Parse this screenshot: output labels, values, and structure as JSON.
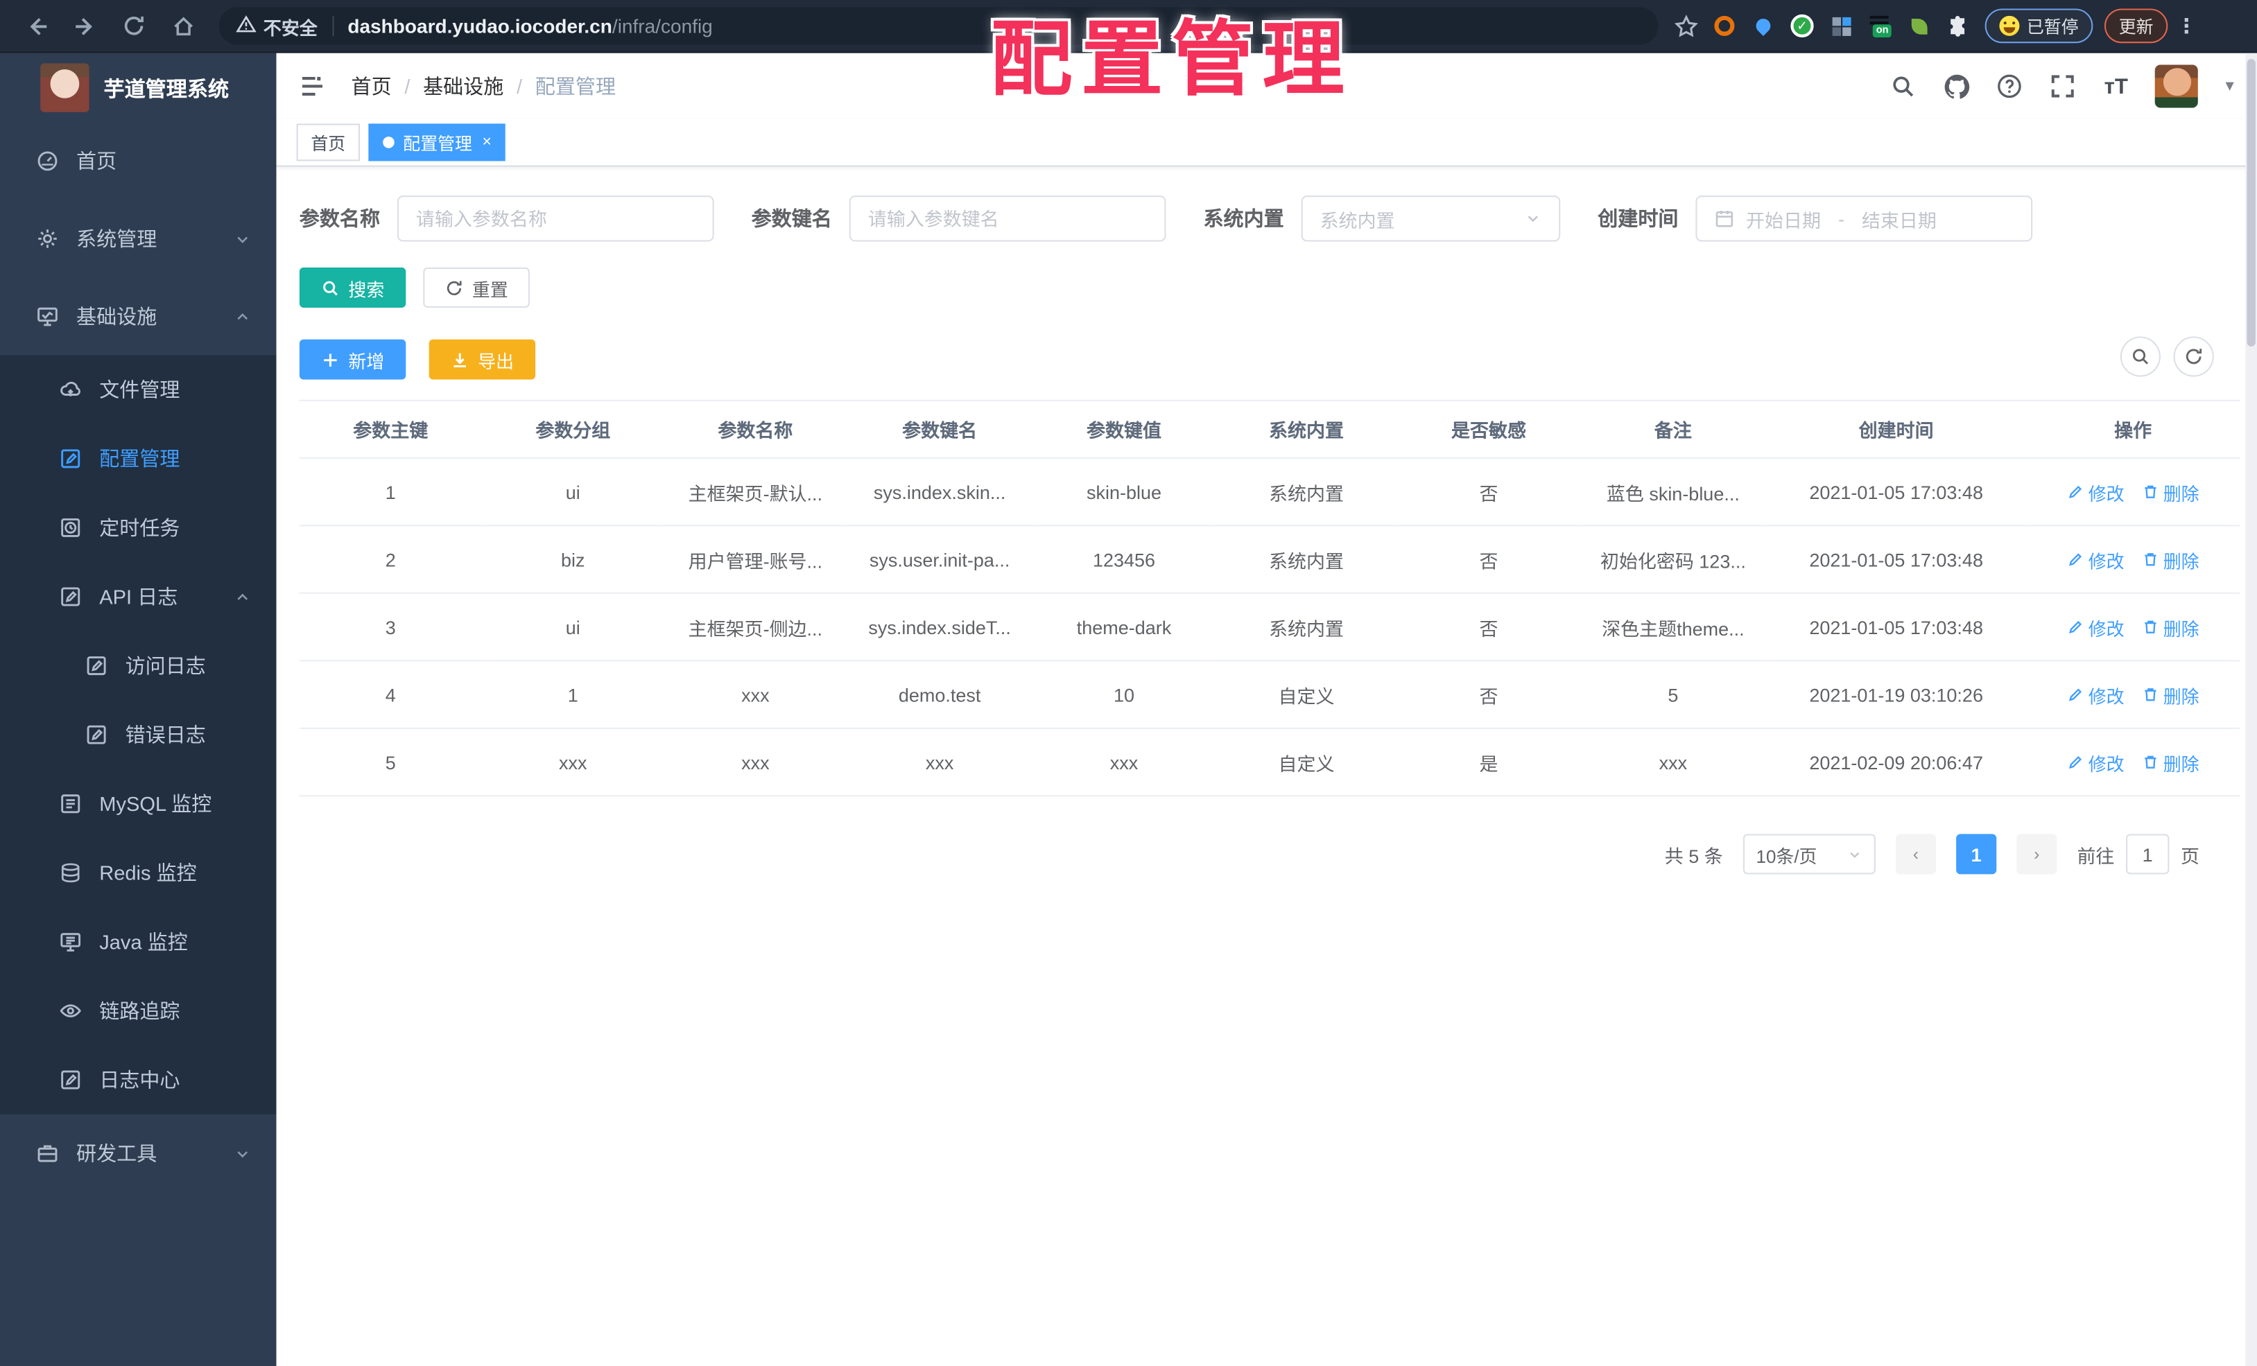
{
  "browser": {
    "security_label": "不安全",
    "url_host": "dashboard.yudao.iocoder.cn",
    "url_path": "/infra/config",
    "paused_chip": "已暂停",
    "update_button": "更新",
    "nav_icons": [
      "back-icon",
      "forward-icon",
      "reload-icon",
      "home-icon"
    ],
    "extension_icons": [
      "bookmark-star-icon",
      "orange-ring-icon",
      "blue-pin-icon",
      "green-check-icon",
      "grid-icon",
      "on-badge-icon",
      "leaf-icon",
      "puzzle-icon"
    ]
  },
  "watermark": "配置管理",
  "sidebar": {
    "title": "芋道管理系统",
    "items": [
      {
        "label": "首页",
        "icon": "dashboard-icon",
        "level": 1,
        "chevron": null,
        "active": false,
        "dark": false
      },
      {
        "label": "系统管理",
        "icon": "gear-icon",
        "level": 1,
        "chevron": "down",
        "active": false,
        "dark": false
      },
      {
        "label": "基础设施",
        "icon": "infra-monitor-icon",
        "level": 1,
        "chevron": "up",
        "active": false,
        "dark": false
      },
      {
        "label": "文件管理",
        "icon": "cloud-icon",
        "level": 2,
        "chevron": null,
        "active": false,
        "dark": true
      },
      {
        "label": "配置管理",
        "icon": "edit-square-icon",
        "level": 2,
        "chevron": null,
        "active": true,
        "dark": true
      },
      {
        "label": "定时任务",
        "icon": "clock-icon",
        "level": 2,
        "chevron": null,
        "active": false,
        "dark": true
      },
      {
        "label": "API 日志",
        "icon": "log-icon",
        "level": 2,
        "chevron": "up",
        "active": false,
        "dark": true
      },
      {
        "label": "访问日志",
        "icon": "log-icon",
        "level": 3,
        "chevron": null,
        "active": false,
        "dark": true
      },
      {
        "label": "错误日志",
        "icon": "log-icon",
        "level": 3,
        "chevron": null,
        "active": false,
        "dark": true
      },
      {
        "label": "MySQL 监控",
        "icon": "database-icon",
        "level": 2,
        "chevron": null,
        "active": false,
        "dark": true
      },
      {
        "label": "Redis 监控",
        "icon": "layers-icon",
        "level": 2,
        "chevron": null,
        "active": false,
        "dark": true
      },
      {
        "label": "Java 监控",
        "icon": "java-monitor-icon",
        "level": 2,
        "chevron": null,
        "active": false,
        "dark": true
      },
      {
        "label": "链路追踪",
        "icon": "eye-icon",
        "level": 2,
        "chevron": null,
        "active": false,
        "dark": true
      },
      {
        "label": "日志中心",
        "icon": "log-icon",
        "level": 2,
        "chevron": null,
        "active": false,
        "dark": true
      },
      {
        "label": "研发工具",
        "icon": "briefcase-icon",
        "level": 1,
        "chevron": "down",
        "active": false,
        "dark": false
      }
    ]
  },
  "header": {
    "breadcrumb": [
      "首页",
      "基础设施",
      "配置管理"
    ],
    "right_icons": [
      "search-icon",
      "github-icon",
      "question-icon",
      "fullscreen-icon",
      "font-size-icon",
      "avatar",
      "caret-down-icon"
    ],
    "font_size_glyph": "тT"
  },
  "tabs": [
    {
      "label": "首页",
      "active": false,
      "closable": false
    },
    {
      "label": "配置管理",
      "active": true,
      "closable": true,
      "close_glyph": "×"
    }
  ],
  "filters": {
    "name_label": "参数名称",
    "name_placeholder": "请输入参数名称",
    "key_label": "参数键名",
    "key_placeholder": "请输入参数键名",
    "type_label": "系统内置",
    "type_placeholder": "系统内置",
    "time_label": "创建时间",
    "date_start_placeholder": "开始日期",
    "date_separator": "-",
    "date_end_placeholder": "结束日期",
    "search_button": "搜索",
    "reset_button": "重置"
  },
  "toolbar": {
    "add_button": "新增",
    "export_button": "导出"
  },
  "table": {
    "headers": [
      "参数主键",
      "参数分组",
      "参数名称",
      "参数键名",
      "参数键值",
      "系统内置",
      "是否敏感",
      "备注",
      "创建时间",
      "操作"
    ],
    "action_edit": "修改",
    "action_delete": "删除",
    "rows": [
      {
        "id": "1",
        "group": "ui",
        "name": "主框架页-默认...",
        "key": "sys.index.skin...",
        "value": "skin-blue",
        "type": "系统内置",
        "sensitive": "否",
        "remark": "蓝色 skin-blue...",
        "time": "2021-01-05 17:03:48"
      },
      {
        "id": "2",
        "group": "biz",
        "name": "用户管理-账号...",
        "key": "sys.user.init-pa...",
        "value": "123456",
        "type": "系统内置",
        "sensitive": "否",
        "remark": "初始化密码 123...",
        "time": "2021-01-05 17:03:48"
      },
      {
        "id": "3",
        "group": "ui",
        "name": "主框架页-侧边...",
        "key": "sys.index.sideT...",
        "value": "theme-dark",
        "type": "系统内置",
        "sensitive": "否",
        "remark": "深色主题theme...",
        "time": "2021-01-05 17:03:48"
      },
      {
        "id": "4",
        "group": "1",
        "name": "xxx",
        "key": "demo.test",
        "value": "10",
        "type": "自定义",
        "sensitive": "否",
        "remark": "5",
        "time": "2021-01-19 03:10:26"
      },
      {
        "id": "5",
        "group": "xxx",
        "name": "xxx",
        "key": "xxx",
        "value": "xxx",
        "type": "自定义",
        "sensitive": "是",
        "remark": "xxx",
        "time": "2021-02-09 20:06:47"
      }
    ]
  },
  "pagination": {
    "total_text": "共 5 条",
    "page_size": "10条/页",
    "prev_glyph": "‹",
    "next_glyph": "›",
    "current_page": "1",
    "goto_label": "前往",
    "goto_value": "1",
    "page_suffix": "页"
  },
  "colors": {
    "primary": "#409eff",
    "teal": "#17b3a3",
    "warning": "#f7b11c",
    "sidebar_bg": "#2f3d52",
    "submenu_bg": "#212f40",
    "tab_active": "#409eff",
    "watermark": "#f3315a"
  }
}
